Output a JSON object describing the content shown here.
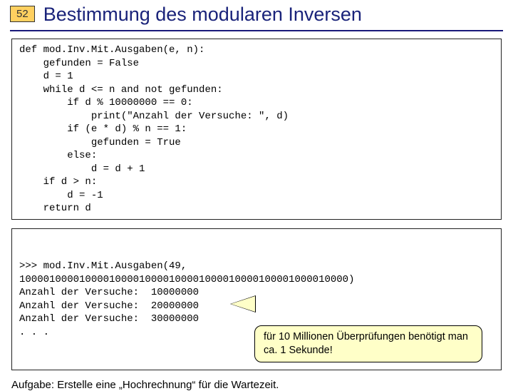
{
  "page": {
    "number": "52",
    "title": "Bestimmung des modularen Inversen"
  },
  "code": "def mod.Inv.Mit.Ausgaben(e, n):\n    gefunden = False\n    d = 1\n    while d <= n and not gefunden:\n        if d % 10000000 == 0:\n            print(\"Anzahl der Versuche: \", d)\n        if (e * d) % n == 1:\n            gefunden = True\n        else:\n            d = d + 1\n    if d > n:\n        d = -1\n    return d",
  "output": ">>> mod.Inv.Mit.Ausgaben(49,\n1000010000100001000010000100001000010000100001000010000)\nAnzahl der Versuche:  10000000\nAnzahl der Versuche:  20000000\nAnzahl der Versuche:  30000000\n. . .",
  "callout": "für 10 Millionen Überprüfungen benötigt man ca. 1 Sekunde!",
  "task": "Aufgabe: Erstelle eine „Hochrechnung“ für die Wartezeit."
}
